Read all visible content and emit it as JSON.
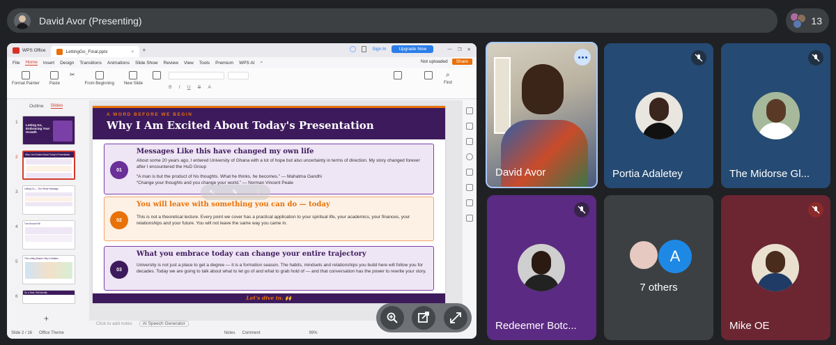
{
  "meeting": {
    "presenter_title": "David Avor (Presenting)",
    "participant_count": "13"
  },
  "wps": {
    "app_tab": "WPS Office",
    "doc_tab": "LettingGo_Final.pptx",
    "sign_in": "Sign In",
    "upgrade": "Upgrade Now",
    "menu": [
      "File",
      "Home",
      "Insert",
      "Design",
      "Transitions",
      "Animations",
      "Slide Show",
      "Review",
      "View",
      "Tools",
      "Premium",
      "WPS AI"
    ],
    "not_uploaded": "Not uploaded",
    "share": "Share",
    "ribbon": {
      "format_painter": "Format Painter",
      "paste": "Paste",
      "from_beginning": "From Beginning",
      "new_slide": "New Slide",
      "find": "Find"
    },
    "panel_tabs": [
      "Outline",
      "Slides"
    ],
    "thumb_numbers": [
      "1",
      "2",
      "3",
      "4",
      "5",
      "6"
    ],
    "notes_placeholder": "Click to add notes",
    "ai_speech": "AI Speech Generator",
    "status": {
      "slide": "Slide 2 / 16",
      "theme": "Office Theme",
      "notes": "Notes",
      "comment": "Comment",
      "zoom": "99%"
    }
  },
  "slide": {
    "kicker": "A WORD BEFORE WE BEGIN",
    "title": "Why I Am Excited About Today's Presentation",
    "cards": [
      {
        "num": "01",
        "title": "Messages Like this have changed my own life",
        "body": "About some 20 years ago, I entered University of Ghana with a lot of hope but also uncertainty in terms of direction. My story changed forever after I encountered the HuD Group",
        "quote1": "“A man is but the product of his thoughts. What he thinks, he becomes.” — Mahatma Gandhi",
        "quote2": "“Change your thoughts and you change your world.” — Norman Vincent Peale"
      },
      {
        "num": "02",
        "title": "You will leave with something you can do — today",
        "body": "This is not a theoretical lecture. Every point we cover has a practical application to your spiritual life, your academics, your finances, your relationships and your future. You will not leave the same way you came in."
      },
      {
        "num": "03",
        "title": "What you embrace today can change your entire trajectory",
        "body": "University is not just a place to get a degree — it is a formation season. The habits, mindsets and relationships you build here will follow you for decades. Today we are going to talk about what to let go of and what to grab hold of — and that conversation has the power to rewrite your story."
      }
    ],
    "footer": "Let's dive in. 🙌"
  },
  "thumbs": [
    {
      "title": "Letting Go, Embracing Your Growth"
    },
    {
      "title": "Why I Am Excited About Today's Presentation"
    },
    {
      "title": "Letting Go — The Whole Message"
    },
    {
      "title": "Turn Around Hill"
    },
    {
      "title": "The Letting Basket: Why It Matters"
    },
    {
      "title": "Do a Seat: Self-Identity"
    }
  ],
  "tiles": [
    {
      "name": "David Avor",
      "muted": false
    },
    {
      "name": "Portia Adaletey",
      "muted": true
    },
    {
      "name": "The Midorse Gl...",
      "muted": true
    },
    {
      "name": "Redeemer Botc...",
      "muted": true
    },
    {
      "name": "7 others",
      "avatar_letter": "A"
    },
    {
      "name": "Mike OE",
      "muted": true
    }
  ],
  "colors": {
    "meet_bg": "#202124",
    "slide_purple": "#3d1a5c",
    "slide_orange": "#e8710a",
    "active_speaker": "#a8c7fa"
  }
}
